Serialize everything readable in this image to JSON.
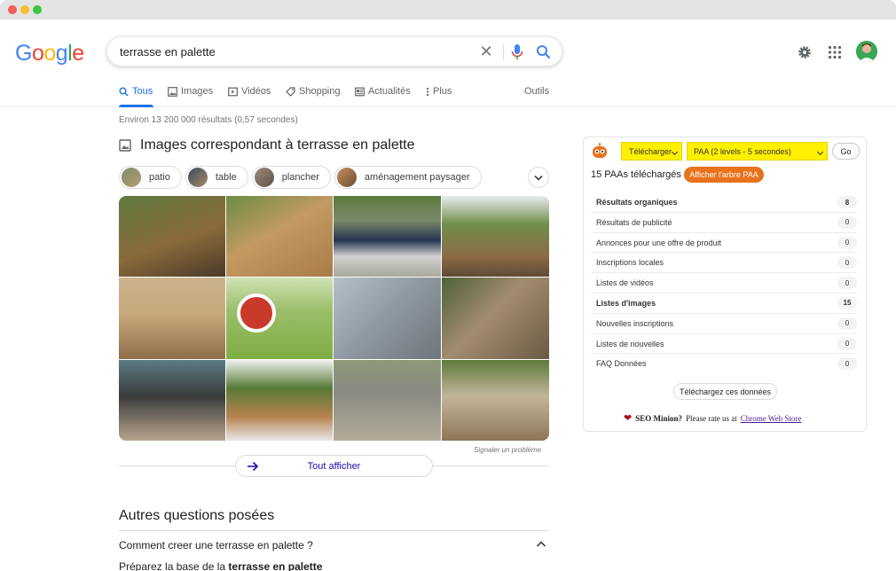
{
  "search": {
    "query": "terrasse en palette"
  },
  "tabs": [
    {
      "label": "Tous"
    },
    {
      "label": "Images"
    },
    {
      "label": "Vidéos"
    },
    {
      "label": "Shopping"
    },
    {
      "label": "Actualités"
    },
    {
      "label": "Plus"
    }
  ],
  "tools_label": "Outils",
  "result_stats": "Environ 13 200 000 résultats (0,57 secondes)",
  "images": {
    "heading": "Images correspondant à terrasse en palette",
    "chips": [
      {
        "label": "patio"
      },
      {
        "label": "table"
      },
      {
        "label": "plancher"
      },
      {
        "label": "aménagement paysager"
      }
    ],
    "report_label": "Signaler un problème",
    "show_all_label": "Tout afficher"
  },
  "paa": {
    "title": "Autres questions posées",
    "question": "Comment creer une terrasse en palette ?",
    "answer_prefix": "Préparez la base de la ",
    "answer_bold": "terrasse en palette"
  },
  "seo_minion": {
    "download_label": "Télécharger",
    "paa_select_label": "PAA (2 levels - 5 secondes)",
    "go_label": "Go",
    "paa_count_text": "15 PAAs téléchargés",
    "tree_button_label": "Afficher l'arbre PAA",
    "rows": [
      {
        "label": "Résultats organiques",
        "count": "8"
      },
      {
        "label": "Résultats de publicité",
        "count": "0"
      },
      {
        "label": "Annonces pour une offre de produit",
        "count": "0"
      },
      {
        "label": "Inscriptions locales",
        "count": "0"
      },
      {
        "label": "Listes de vidéos",
        "count": "0"
      },
      {
        "label": "Listes d'images",
        "count": "15"
      },
      {
        "label": "Nouvelles inscriptions",
        "count": "0"
      },
      {
        "label": "Listes de nouvelles",
        "count": "0"
      },
      {
        "label": "FAQ Données",
        "count": "0"
      }
    ],
    "export_label": "Téléchargez ces données",
    "rate_brand": "SEO Minion?",
    "rate_text": "Please rate us at",
    "rate_link": "Chrome Web Store"
  },
  "colors": {
    "accent": "#1a73e8",
    "minion_yellow": "#ffef00",
    "minion_orange": "#e8731d"
  }
}
